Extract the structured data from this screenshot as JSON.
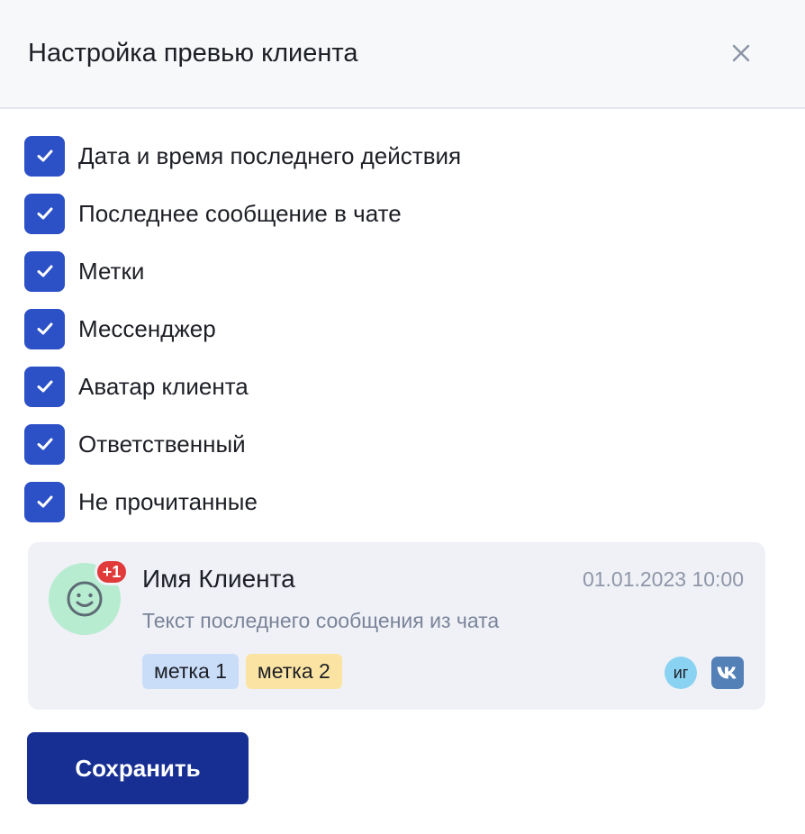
{
  "modal": {
    "title": "Настройка превью клиента",
    "close_icon": "close-icon"
  },
  "options": [
    {
      "label": "Дата и время последнего действия",
      "checked": true
    },
    {
      "label": "Последнее сообщение в чате",
      "checked": true
    },
    {
      "label": "Метки",
      "checked": true
    },
    {
      "label": "Мессенджер",
      "checked": true
    },
    {
      "label": "Аватар клиента",
      "checked": true
    },
    {
      "label": "Ответственный",
      "checked": true
    },
    {
      "label": "Не прочитанные",
      "checked": true
    }
  ],
  "preview": {
    "avatar_icon": "smiley-face-icon",
    "unread_badge": "+1",
    "client_name": "Имя Клиента",
    "datetime": "01.01.2023 10:00",
    "last_message": "Текст последнего сообщения из чата",
    "tags": [
      {
        "label": "метка 1",
        "color": "#c9ddf8"
      },
      {
        "label": "метка 2",
        "color": "#fbe4a3"
      }
    ],
    "messengers": [
      {
        "label": "иг",
        "icon": "instagram-icon",
        "color": "#8ad2f1"
      },
      {
        "label": "",
        "icon": "vk-icon",
        "color": "#5480b8"
      }
    ]
  },
  "actions": {
    "save_label": "Сохранить"
  },
  "colors": {
    "accent": "#2c50c6",
    "primary_button": "#172f93",
    "badge": "#e03a3a"
  }
}
